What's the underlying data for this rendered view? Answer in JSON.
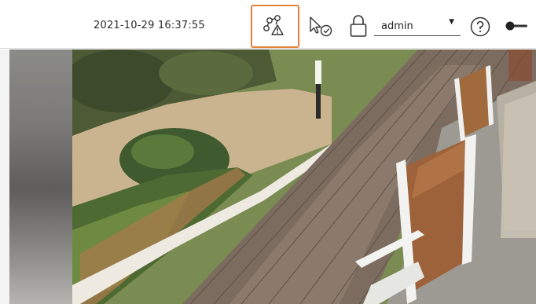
{
  "header": {
    "datetime": "2021-10-29 16:37:55",
    "user": {
      "value": "admin"
    }
  },
  "icons": {
    "warning": "network-warning-icon",
    "cursor_check": "cursor-check-icon",
    "lock": "lock-icon",
    "dropdown": "caret-down-icon",
    "help": "help-icon",
    "toggle": "toggle-icon"
  },
  "colors": {
    "warning_highlight": "#e5823a",
    "topbar_bg": "#ffffff"
  }
}
